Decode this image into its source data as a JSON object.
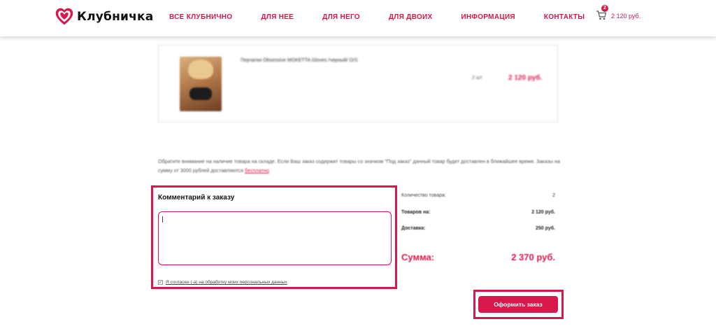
{
  "header": {
    "logo_text": "Клубничка",
    "nav": [
      "ВСЕ КЛУБНИЧНО",
      "ДЛЯ НЕЕ",
      "ДЛЯ НЕГО",
      "ДЛЯ ДВОИХ",
      "ИНФОРМАЦИЯ",
      "КОНТАКТЫ"
    ],
    "cart": {
      "count": "2",
      "total": "2 120 руб."
    }
  },
  "product": {
    "name": "Перчатки Obsessive MOKETTA Gloves /черный/ O/S",
    "qty": "2 шт",
    "price": "2 120 руб."
  },
  "notice": {
    "text": "Обратите внимание на наличие товара на складе. Если Ваш заказ содержит товары со значком \"Под заказ\" данный товар будет доставлен в ближайшее время. Заказы на сумму от 3000 рублей доставляются ",
    "free": "бесплатно",
    "end": "."
  },
  "comment": {
    "title": "Комментарий к заказу",
    "value": "",
    "consent_label": "Я согласен (-а) на обработку моих персональных данных",
    "consent_checked": true
  },
  "summary": {
    "items_label": "Количество товара:",
    "items_value": "2",
    "goods_label": "Товаров на:",
    "goods_value": "2 120 руб.",
    "delivery_label": "Доставка:",
    "delivery_value": "250 руб.",
    "total_label": "Сумма:",
    "total_value": "2 370 руб."
  },
  "submit_label": "Оформить заказ",
  "colors": {
    "accent": "#d8174b"
  }
}
